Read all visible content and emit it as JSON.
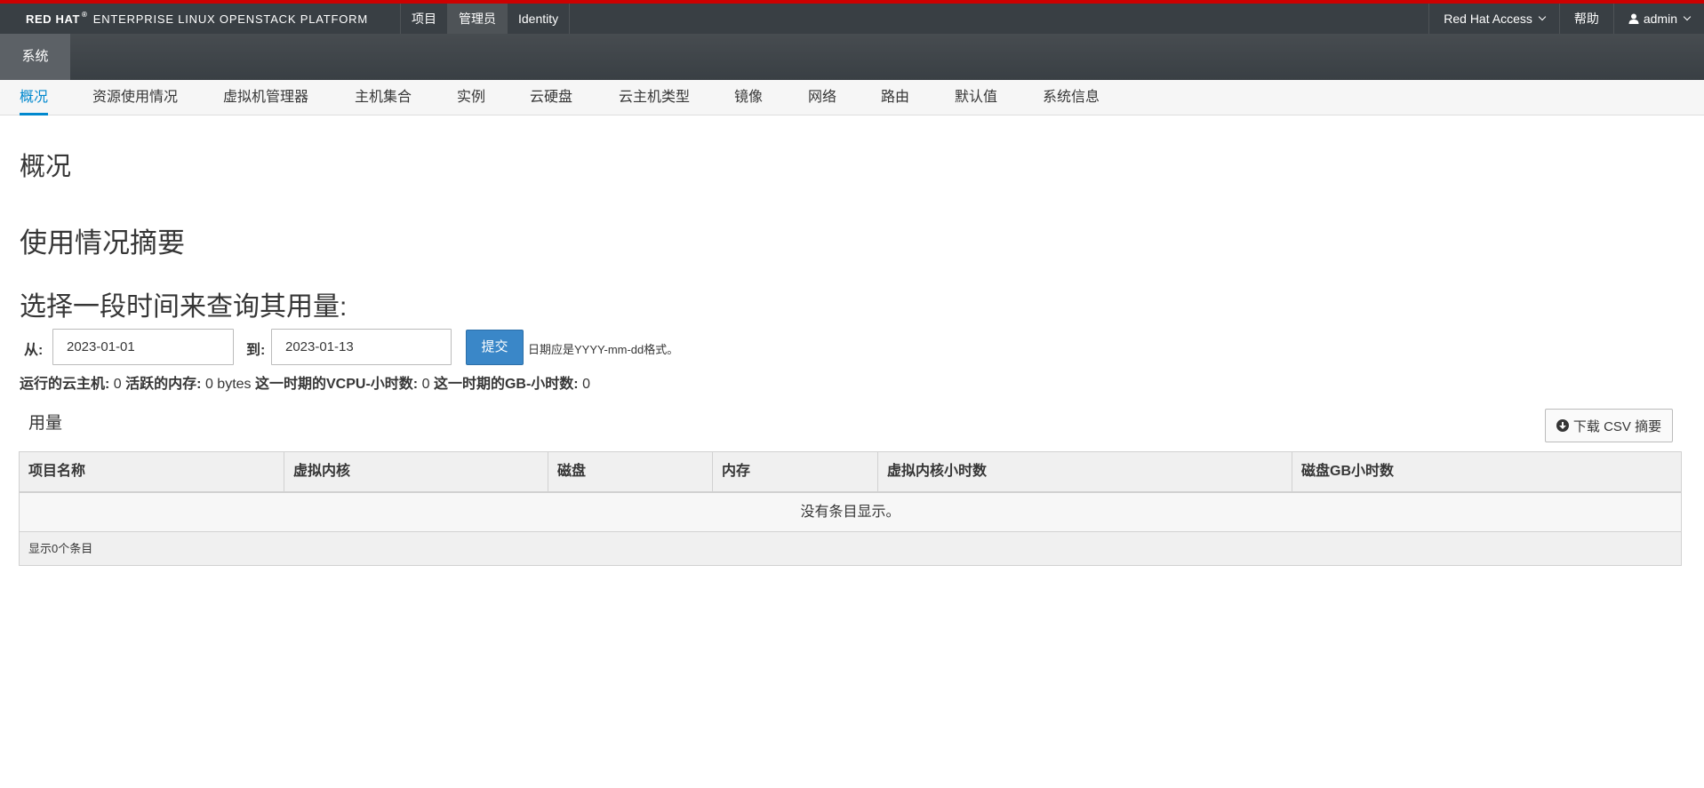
{
  "header": {
    "brand": {
      "redhat": "RED HAT",
      "reg": "®",
      "rest": "ENTERPRISE LINUX OPENSTACK PLATFORM"
    },
    "nav": [
      {
        "label": "项目"
      },
      {
        "label": "管理员",
        "active": true
      },
      {
        "label": "Identity"
      }
    ],
    "utility": {
      "redhat_access": "Red Hat Access",
      "help": "帮助",
      "user": "admin"
    }
  },
  "secondary_nav": {
    "active_tab": "系统"
  },
  "subnav": {
    "items": [
      {
        "label": "概况",
        "active": true
      },
      {
        "label": "资源使用情况"
      },
      {
        "label": "虚拟机管理器"
      },
      {
        "label": "主机集合"
      },
      {
        "label": "实例"
      },
      {
        "label": "云硬盘"
      },
      {
        "label": "云主机类型"
      },
      {
        "label": "镜像"
      },
      {
        "label": "网络"
      },
      {
        "label": "路由"
      },
      {
        "label": "默认值"
      },
      {
        "label": "系统信息"
      }
    ]
  },
  "page": {
    "title": "概况",
    "summary_heading": "使用情况摘要",
    "period_heading": "选择一段时间来查询其用量:",
    "form": {
      "from_label": "从:",
      "from_value": "2023-01-01",
      "to_label": "到:",
      "to_value": "2023-01-13",
      "submit_label": "提交",
      "hint": "日期应是YYYY-mm-dd格式。"
    },
    "stats": {
      "running_label": "运行的云主机:",
      "running_value": "0",
      "memory_label": "活跃的内存:",
      "memory_value": "0 bytes",
      "vcpu_label": "这一时期的VCPU-小时数:",
      "vcpu_value": "0",
      "gb_label": "这一时期的GB-小时数:",
      "gb_value": "0"
    },
    "usage": {
      "title": "用量",
      "csv_button": "下载 CSV 摘要",
      "columns": [
        "项目名称",
        "虚拟内核",
        "磁盘",
        "内存",
        "虚拟内核小时数",
        "磁盘GB小时数"
      ],
      "empty_message": "没有条目显示。",
      "footer": "显示0个条目"
    }
  },
  "colors": {
    "accent": "#0088ce",
    "topbar": "#393f44",
    "top_border": "#cc0000",
    "primary_button": "#3a87c8"
  }
}
